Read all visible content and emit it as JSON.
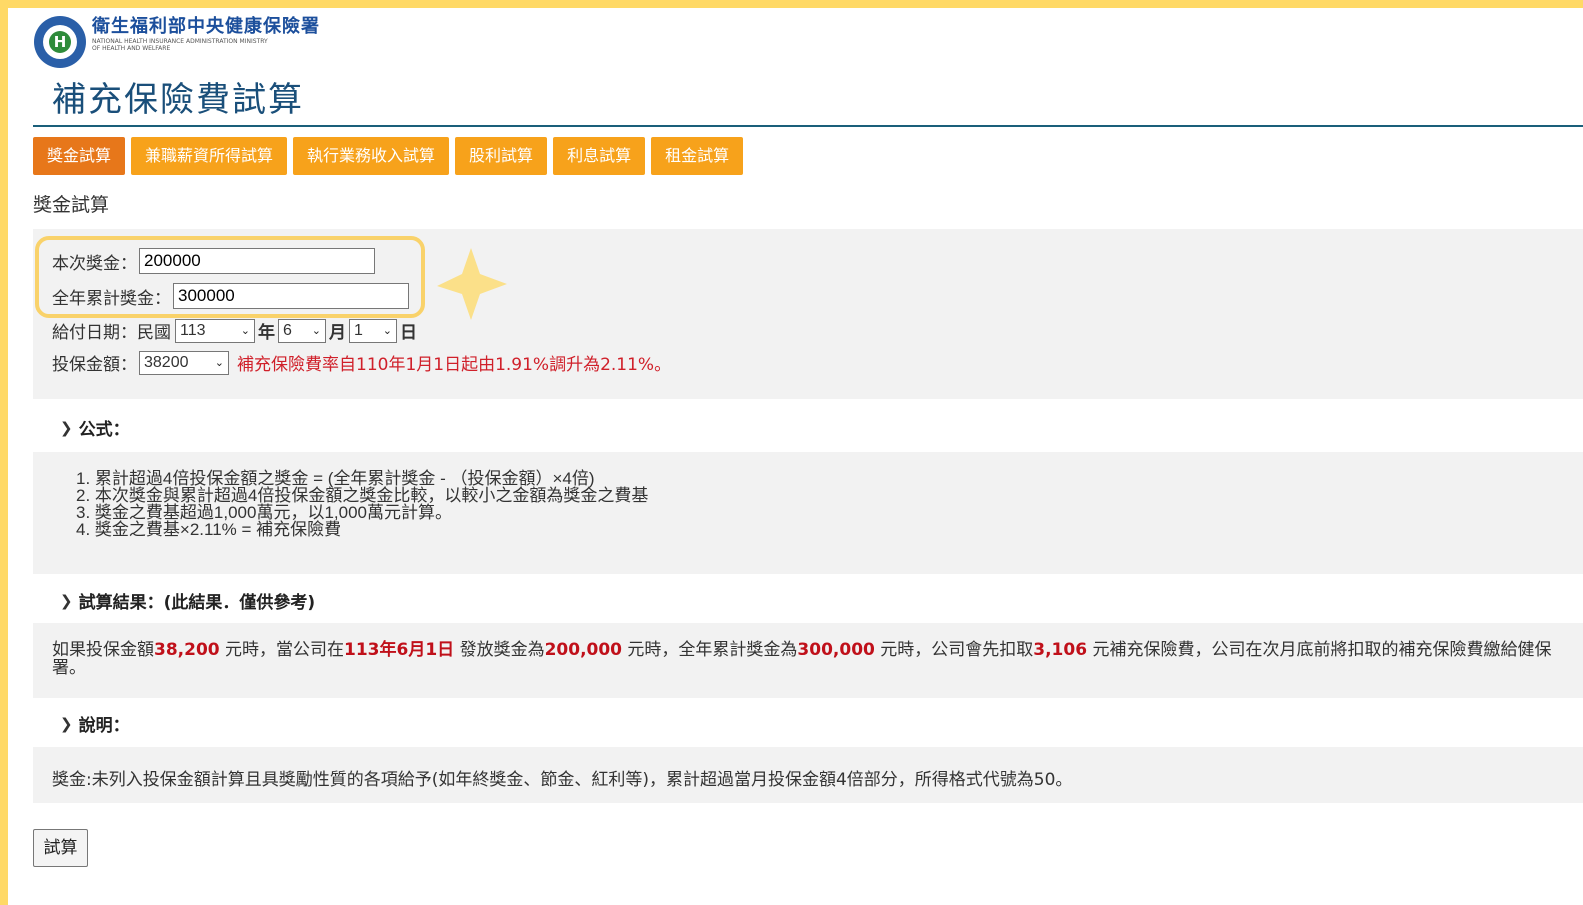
{
  "colors": {
    "frame": "#ffd966",
    "tab": "#f7a21b",
    "tab_active": "#e7771a",
    "accent_red": "#c0101a",
    "title": "#1a4f7a"
  },
  "header": {
    "org_name": "衛生福利部中央健康保險署",
    "org_en_line1": "NATIONAL HEALTH INSURANCE ADMINISTRATION MINISTRY",
    "org_en_line2": "OF HEALTH AND WELFARE",
    "page_title": "補充保險費試算"
  },
  "tabs": [
    "獎金試算",
    "兼職薪資所得試算",
    "執行業務收入試算",
    "股利試算",
    "利息試算",
    "租金試算"
  ],
  "section_title": "獎金試算",
  "form": {
    "bonus_label": "本次獎金：",
    "bonus_value": "200000",
    "annual_label": "全年累計獎金：",
    "annual_value": "300000",
    "date_label": "給付日期：民國",
    "year_value": "113",
    "year_unit": "年",
    "month_value": "6",
    "month_unit": "月",
    "day_value": "1",
    "day_unit": "日",
    "insured_label": "投保金額：",
    "insured_value": "38200",
    "rate_note": "補充保險費率自110年1月1日起由1.91%調升為2.11%。"
  },
  "formula": {
    "heading": "公式：",
    "lines": [
      "1. 累計超過4倍投保金額之獎金 = (全年累計獎金 - （投保金額）×4倍)",
      "2. 本次獎金與累計超過4倍投保金額之獎金比較，以較小之金額為獎金之費基",
      "3. 獎金之費基超過1,000萬元，以1,000萬元計算。",
      "4. 獎金之費基×2.11% = 補充保險費"
    ]
  },
  "result": {
    "heading": "試算結果：(此結果．僅供參考)",
    "t1": "如果投保金額",
    "insured": "38,200",
    "t2": " 元時，當公司在",
    "date": "113年6月1日",
    "t3": " 發放獎金為",
    "bonus": "200,000",
    "t4": " 元時，全年累計獎金為",
    "annual": "300,000",
    "t5": " 元時，公司會先扣取",
    "premium": "3,106",
    "t6": " 元補充保險費，公司在次月底前將扣取的補充保險費繳給健保署。"
  },
  "explain": {
    "heading": "說明：",
    "text": "獎金:未列入投保金額計算且具獎勵性質的各項給予(如年終獎金、節金、紅利等)，累計超過當月投保金額4倍部分，所得格式代號為50。"
  },
  "calc_button": "試算"
}
